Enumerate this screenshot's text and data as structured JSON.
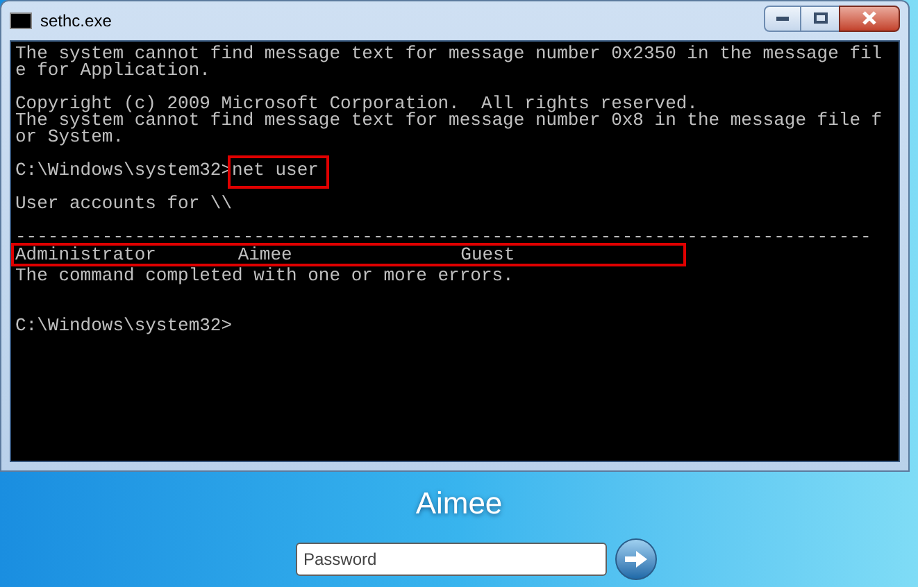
{
  "window": {
    "title": "sethc.exe"
  },
  "console": [
    {
      "kind": "text",
      "text": "The system cannot find message text for message number 0x2350 in the message fil"
    },
    {
      "kind": "text",
      "text": "e for Application."
    },
    {
      "kind": "blank"
    },
    {
      "kind": "text",
      "text": "Copyright (c) 2009 Microsoft Corporation.  All rights reserved."
    },
    {
      "kind": "text",
      "text": "The system cannot find message text for message number 0x8 in the message file f"
    },
    {
      "kind": "text",
      "text": "or System."
    },
    {
      "kind": "blank"
    },
    {
      "kind": "prompt",
      "prompt": "C:\\Windows\\system32>",
      "command": "net user",
      "highlighted": true
    },
    {
      "kind": "blank"
    },
    {
      "kind": "text",
      "text": "User accounts for \\\\"
    },
    {
      "kind": "blank"
    },
    {
      "kind": "text",
      "text": "-------------------------------------------------------------------------------"
    },
    {
      "kind": "accounts",
      "cells": [
        "Administrator",
        "Aimee",
        "Guest"
      ],
      "highlighted": true
    },
    {
      "kind": "text",
      "text": "The command completed with one or more errors."
    },
    {
      "kind": "blank"
    },
    {
      "kind": "blank"
    },
    {
      "kind": "prompt",
      "prompt": "C:\\Windows\\system32>"
    }
  ],
  "login": {
    "username": "Aimee",
    "password": {
      "placeholder": "Password"
    }
  }
}
